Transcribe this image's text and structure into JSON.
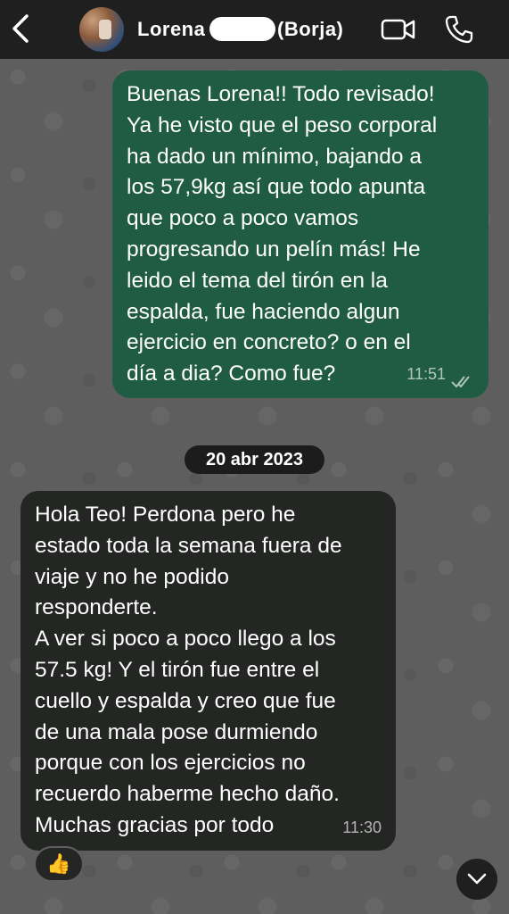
{
  "header": {
    "contact_first": "Lorena",
    "contact_last": "(Borja)",
    "icons": {
      "back": "chevron-left-icon",
      "video": "video-camera-icon",
      "call": "phone-icon"
    }
  },
  "messages": [
    {
      "direction": "outgoing",
      "text": "Buenas Lorena!! Todo revisado!\nYa he visto que el peso corporal\nha dado un mínimo, bajando a\nlos 57,9kg así que todo apunta\nque poco a poco vamos\nprogresando un pelín más! He\nleido el tema del tirón en la\nespalda, fue haciendo algun\nejercicio en concreto? o en el\ndía a dia? Como fue?",
      "time": "11:51",
      "status": "read"
    },
    {
      "direction": "incoming",
      "text": "Hola Teo! Perdona pero he\nestado toda la semana fuera de\nviaje y no he podido\nresponderte.\nA ver si poco a poco llego a los\n57.5 kg! Y el tirón fue entre el\ncuello y espalda y creo que fue\nde una mala pose durmiendo\nporque con los ejercicios no\nrecuerdo haberme hecho daño.\nMuchas gracias por todo",
      "time": "11:30",
      "reaction": "👍"
    }
  ],
  "date_separator": "20 abr 2023",
  "colors": {
    "header_bg": "#1f1f1f",
    "outgoing_bubble": "#1f5c43",
    "incoming_bubble": "#242624",
    "chat_bg": "#5e5e5e"
  }
}
